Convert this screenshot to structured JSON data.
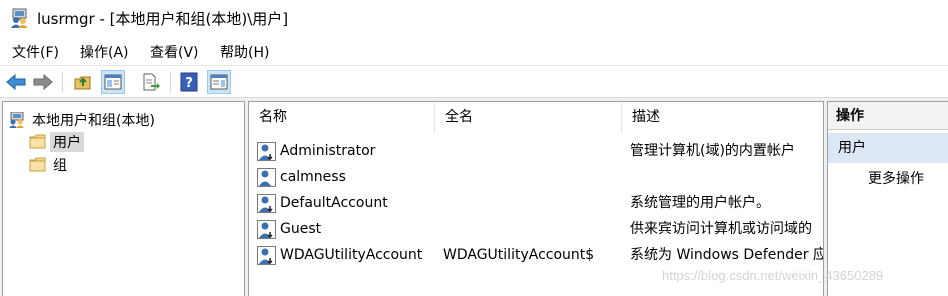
{
  "window": {
    "title": "lusrmgr - [本地用户和组(本地)\\用户]",
    "icon": "users-computer-icon"
  },
  "menu": {
    "items": [
      "文件(F)",
      "操作(A)",
      "查看(V)",
      "帮助(H)"
    ]
  },
  "toolbar": {
    "buttons": [
      "back-arrow-icon",
      "forward-arrow-icon",
      "up-folder-icon",
      "show-hide-console-tree-icon",
      "export-list-icon",
      "help-icon",
      "show-hide-action-pane-icon"
    ]
  },
  "tree": {
    "root": "本地用户和组(本地)",
    "children": [
      {
        "label": "用户",
        "selected": true
      },
      {
        "label": "组",
        "selected": false
      }
    ]
  },
  "list": {
    "columns": [
      "名称",
      "全名",
      "描述"
    ],
    "rows": [
      {
        "name": "Administrator",
        "fullname": "",
        "description": "管理计算机(域)的内置帐户"
      },
      {
        "name": "calmness",
        "fullname": "",
        "description": ""
      },
      {
        "name": "DefaultAccount",
        "fullname": "",
        "description": "系统管理的用户帐户。"
      },
      {
        "name": "Guest",
        "fullname": "",
        "description": "供来宾访问计算机或访问域的"
      },
      {
        "name": "WDAGUtilityAccount",
        "fullname": "WDAGUtilityAccount$",
        "description": "系统为 Windows Defender 应"
      }
    ]
  },
  "actions": {
    "header": "操作",
    "section": "用户",
    "more": "更多操作"
  },
  "watermark": "https://blog.csdn.net/weixin_43650289",
  "colors": {
    "selection": "#d9d9d9",
    "action_section": "#dbe7f5",
    "toolbar_pressed": "#cce4f7"
  }
}
